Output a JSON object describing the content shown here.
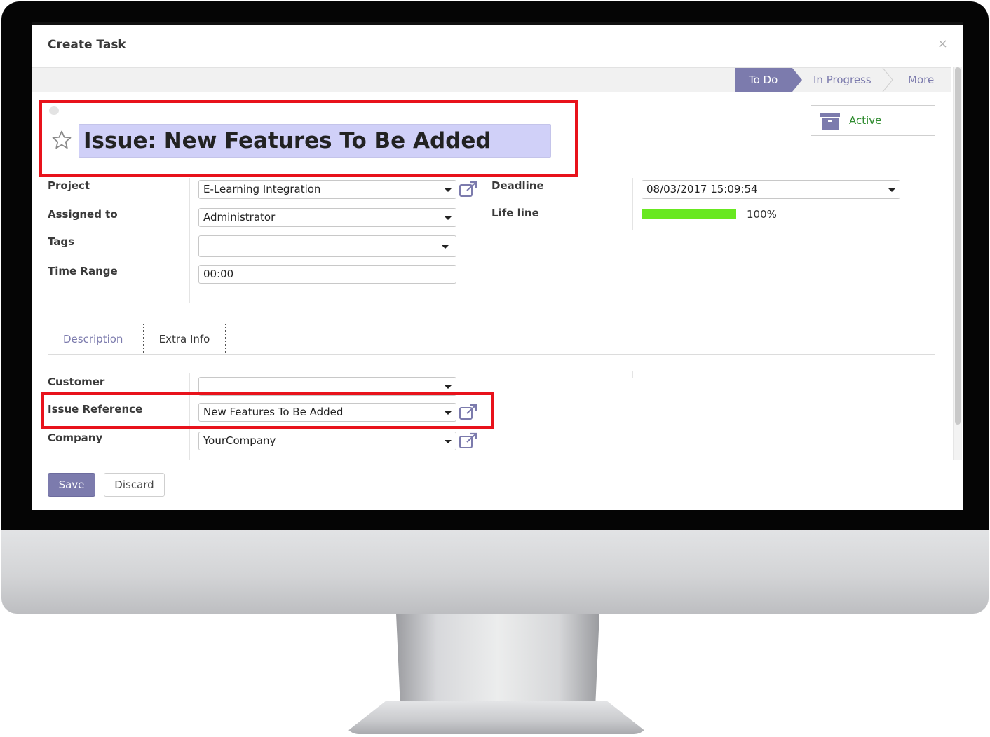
{
  "dialog": {
    "title": "Create Task",
    "close_symbol": "×"
  },
  "stages": {
    "items": [
      "To Do",
      "In Progress",
      "More"
    ],
    "active": "To Do",
    "active_color": "#7c7bad"
  },
  "record": {
    "title": "Issue: New Features To Be Added",
    "starred": false,
    "active_button_label": "Active",
    "active_icon": "archive-box-icon"
  },
  "fields": {
    "project": {
      "label": "Project",
      "value": "E-Learning Integration"
    },
    "assigned_to": {
      "label": "Assigned to",
      "value": "Administrator"
    },
    "tags": {
      "label": "Tags",
      "value": ""
    },
    "time_range": {
      "label": "Time Range",
      "value": "00:00"
    },
    "deadline": {
      "label": "Deadline",
      "value": "08/03/2017 15:09:54"
    },
    "life_line": {
      "label": "Life line",
      "percent_text": "100%",
      "progress": 1.0,
      "bar_color": "#68e820"
    }
  },
  "tabs": {
    "items": [
      "Description",
      "Extra Info"
    ],
    "active": "Extra Info"
  },
  "extra_info": {
    "customer": {
      "label": "Customer",
      "value": ""
    },
    "issue_reference": {
      "label": "Issue Reference",
      "value": "New Features To Be Added"
    },
    "company": {
      "label": "Company",
      "value": "YourCompany"
    }
  },
  "footer": {
    "save_label": "Save",
    "discard_label": "Discard"
  },
  "highlight_color": "#e8121b"
}
